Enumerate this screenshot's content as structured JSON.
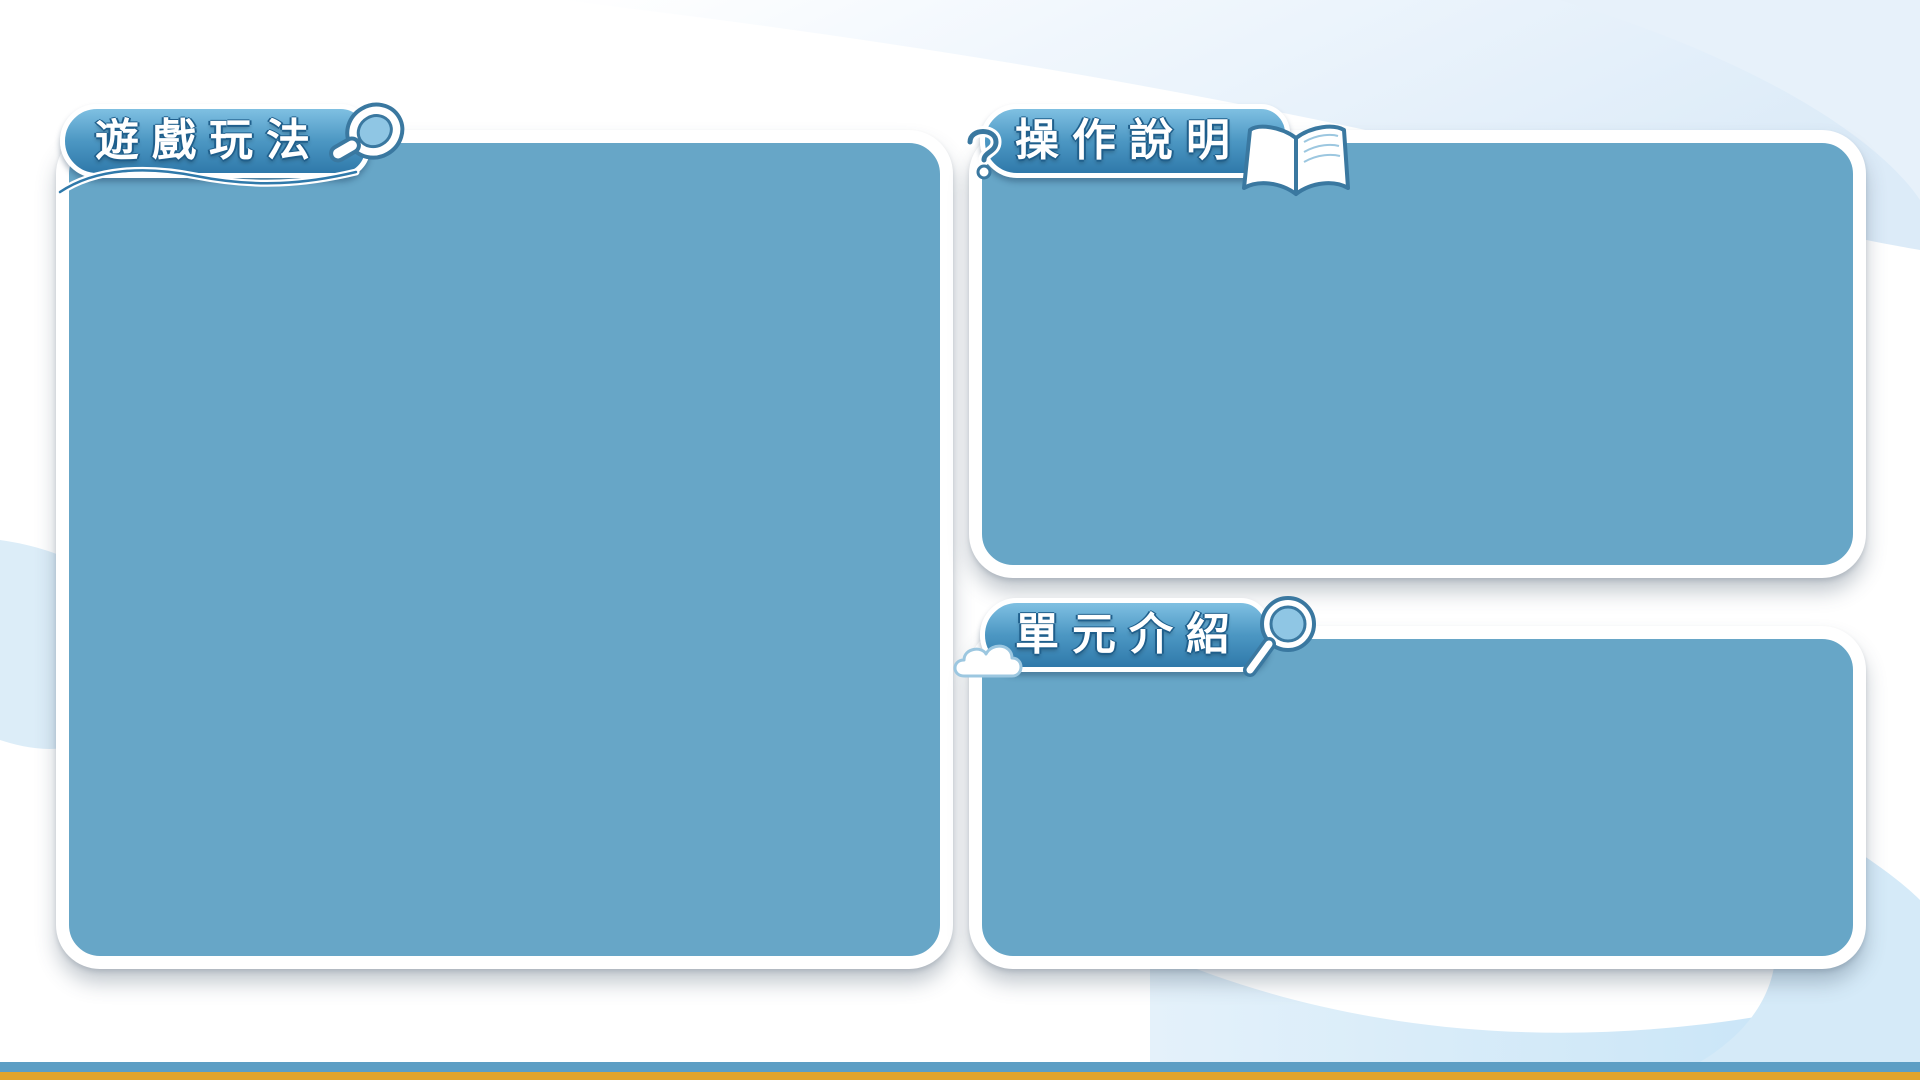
{
  "colors": {
    "panel_fill": "#67a6c7",
    "panel_border": "#ffffff",
    "tab_fill_top": "#7fc0e2",
    "tab_fill_bottom": "#2f79aa",
    "background_wave": "#cfe7f7",
    "bottom_bar_blue": "#5d9ec4",
    "bottom_bar_gold": "#e3a42a"
  },
  "panels": {
    "gameplay": {
      "title": "遊戲玩法",
      "icon": "magnifier-icon"
    },
    "instructions": {
      "title": "操作說明",
      "icon": "open-book-icon",
      "accent_icon": "question-mark-icon"
    },
    "unit_intro": {
      "title": "單元介紹",
      "icon": "magnifier-icon",
      "accent_icon": "cloud-icon"
    }
  }
}
